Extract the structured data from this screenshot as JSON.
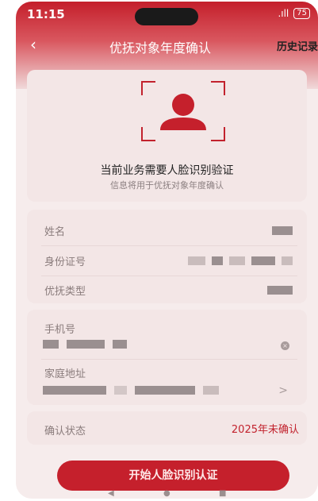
{
  "status_bar": {
    "time": "11:15",
    "signal": ".ıll",
    "battery": "75"
  },
  "nav": {
    "back_icon": "‹",
    "title": "优抚对象年度确认",
    "history": "历史记录"
  },
  "face": {
    "title": "当前业务需要人脸识别验证",
    "subtitle": "信息将用于优抚对象年度确认"
  },
  "info": {
    "name_label": "姓名",
    "id_label": "身份证号",
    "type_label": "优抚类型"
  },
  "contact": {
    "phone_label": "手机号",
    "address_label": "家庭地址",
    "clear_icon": "×",
    "chevron_icon": ">"
  },
  "status": {
    "label": "确认状态",
    "value": "2025年未确认"
  },
  "actions": {
    "start": "开始人脸识别认证"
  },
  "colors": {
    "accent": "#c5202c"
  }
}
